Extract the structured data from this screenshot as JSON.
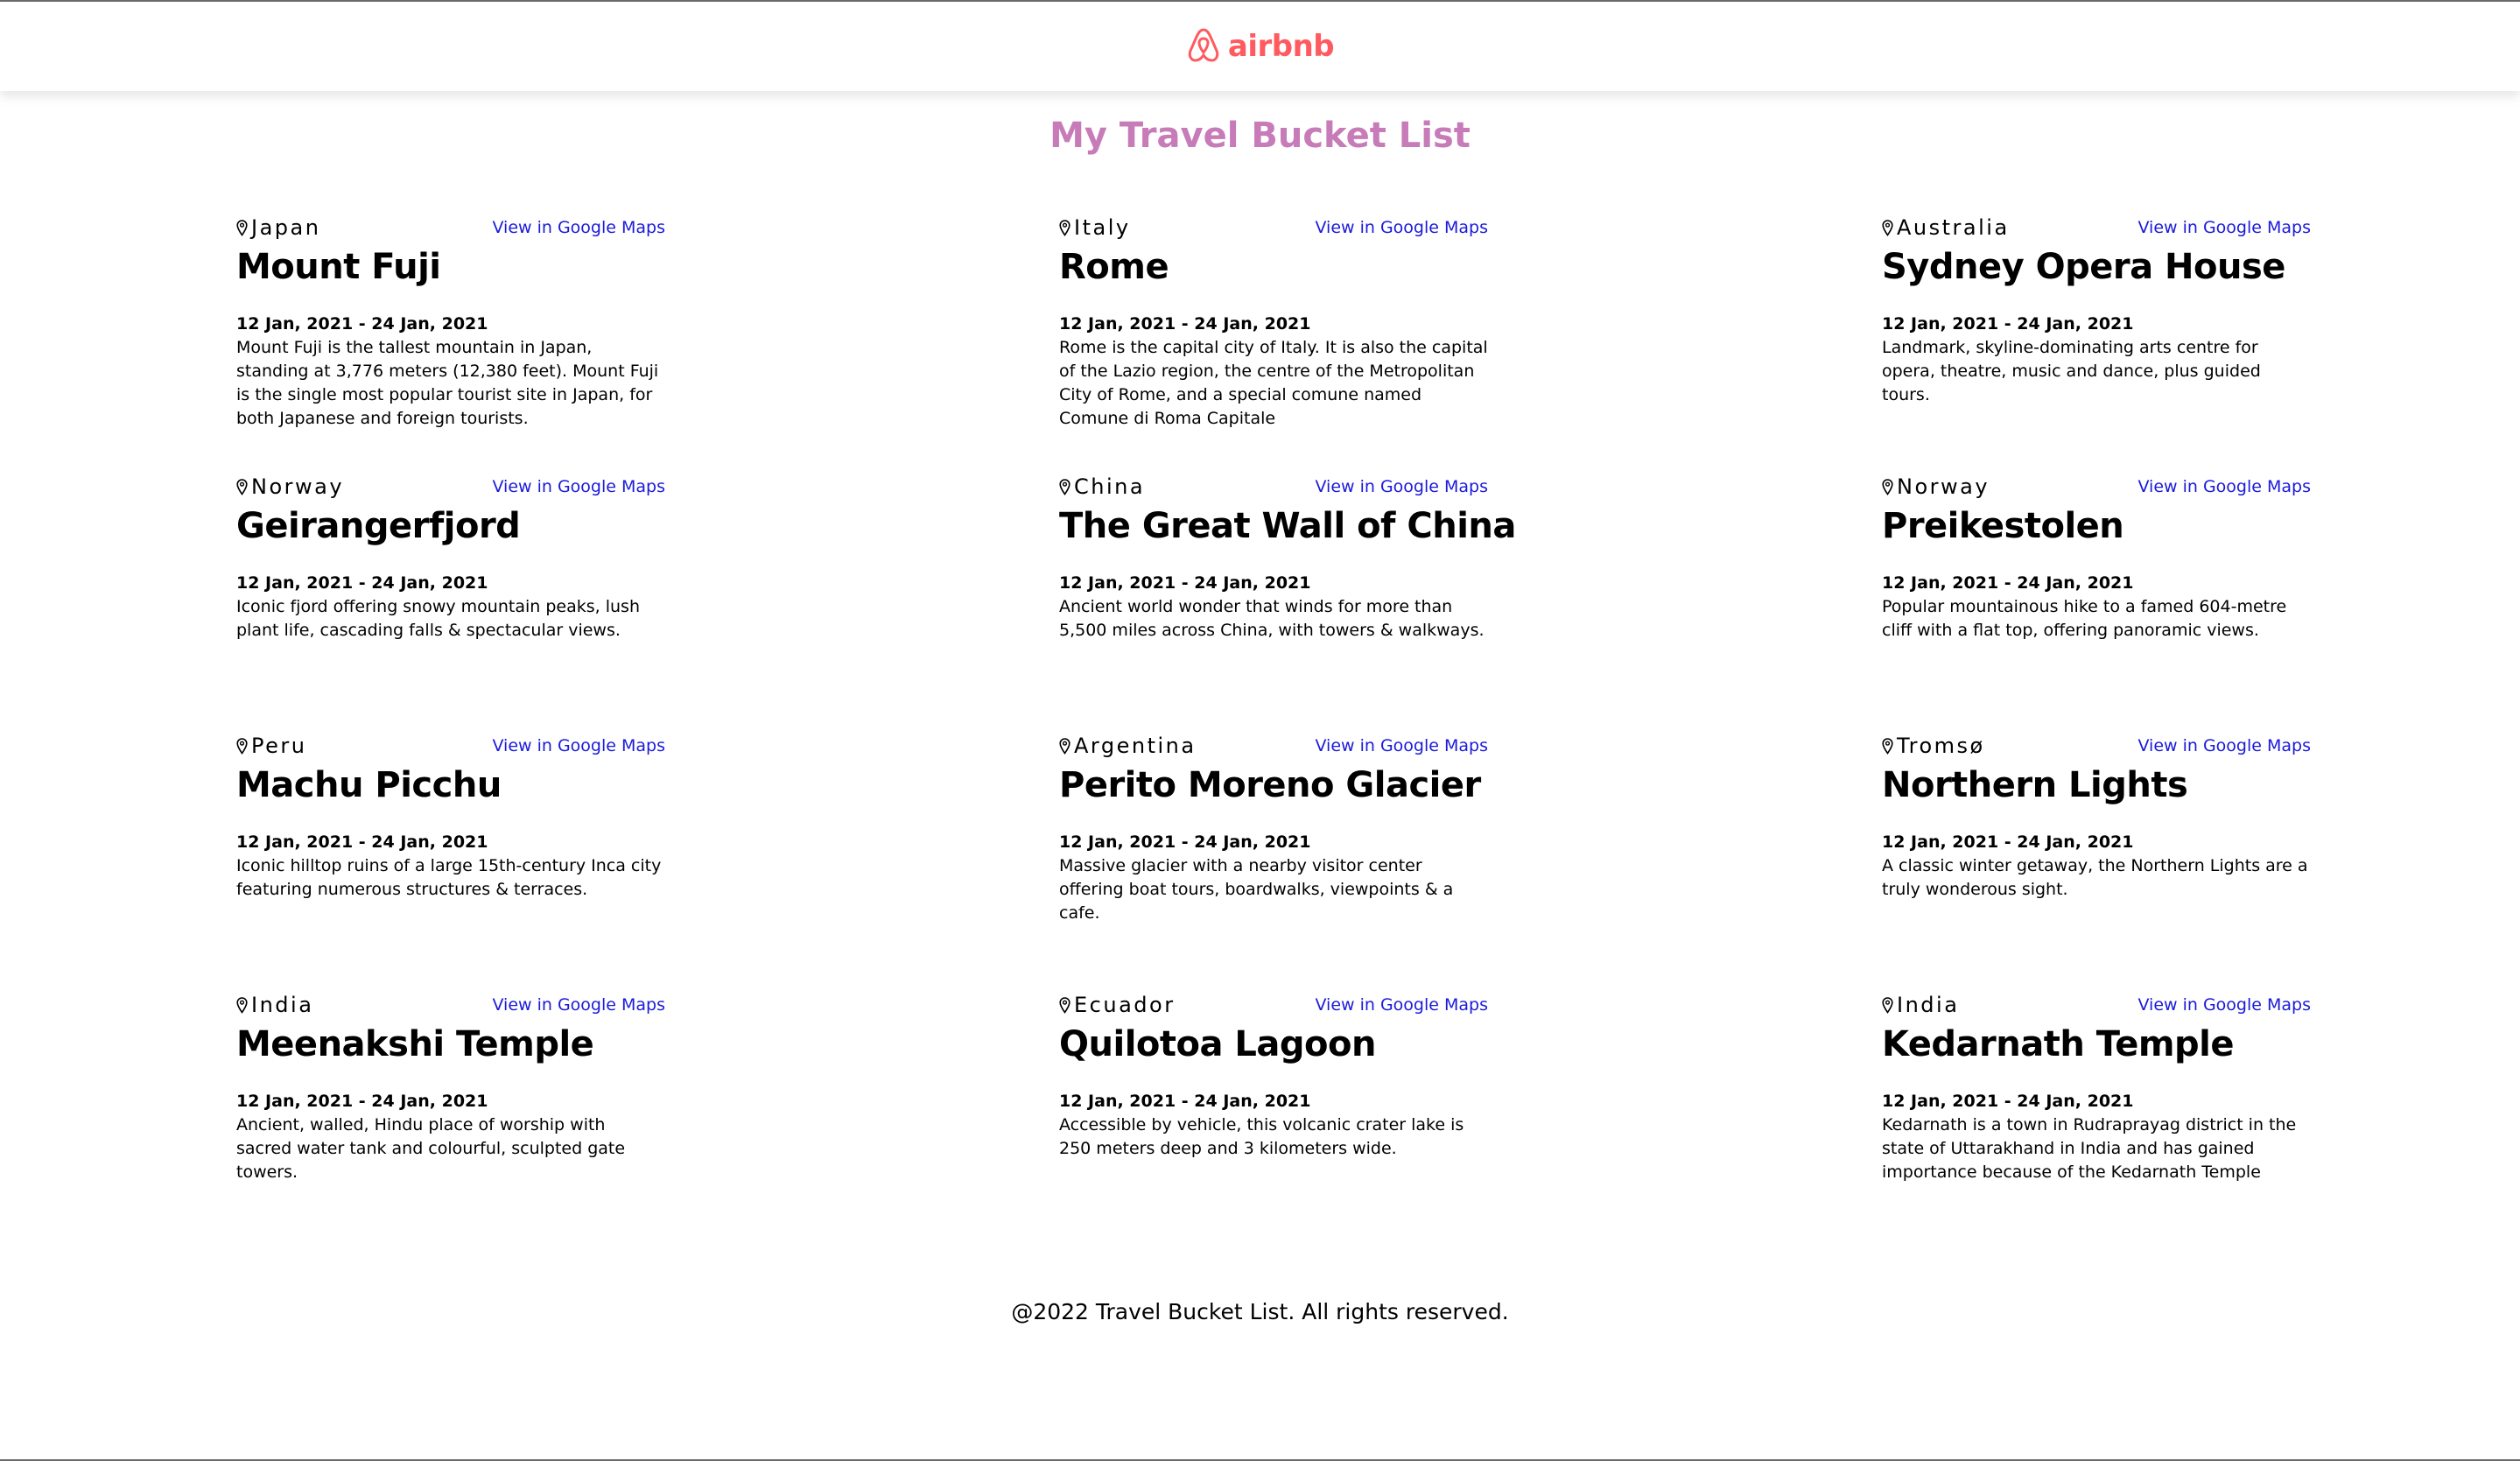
{
  "header": {
    "logo_text": "airbnb",
    "brand_color": "#FF5A5F",
    "logo_icon": "airbnb-logo-icon"
  },
  "page": {
    "title": "My Travel Bucket List",
    "title_color": "#C77BB8"
  },
  "entries": [
    {
      "country": "Japan",
      "link": "View in Google Maps",
      "title": "Mount Fuji",
      "dates": "12 Jan, 2021 - 24 Jan, 2021",
      "description": "Mount Fuji is the tallest mountain in Japan, standing at 3,776 meters (12,380 feet). Mount Fuji is the single most popular tourist site in Japan, for both Japanese and foreign tourists."
    },
    {
      "country": "Italy",
      "link": "View in Google Maps",
      "title": "Rome",
      "dates": "12 Jan, 2021 - 24 Jan, 2021",
      "description": "Rome is the capital city of Italy. It is also the capital of the Lazio region, the centre of the Metropolitan City of Rome, and a special comune named Comune di Roma Capitale"
    },
    {
      "country": "Australia",
      "link": "View in Google Maps",
      "title": "Sydney Opera House",
      "dates": "12 Jan, 2021 - 24 Jan, 2021",
      "description": "Landmark, skyline-dominating arts centre for opera, theatre, music and dance, plus guided tours."
    },
    {
      "country": "Norway",
      "link": "View in Google Maps",
      "title": "Geirangerfjord",
      "dates": "12 Jan, 2021 - 24 Jan, 2021",
      "description": "Iconic fjord offering snowy mountain peaks, lush plant life, cascading falls & spectacular views."
    },
    {
      "country": "China",
      "link": "View in Google Maps",
      "title": "The Great Wall of China",
      "dates": "12 Jan, 2021 - 24 Jan, 2021",
      "description": "Ancient world wonder that winds for more than 5,500 miles across China, with towers & walkways."
    },
    {
      "country": "Norway",
      "link": "View in Google Maps",
      "title": "Preikestolen",
      "dates": "12 Jan, 2021 - 24 Jan, 2021",
      "description": "Popular mountainous hike to a famed 604-metre cliff with a flat top, offering panoramic views."
    },
    {
      "country": "Peru",
      "link": "View in Google Maps",
      "title": "Machu Picchu",
      "dates": "12 Jan, 2021 - 24 Jan, 2021",
      "description": "Iconic hilltop ruins of a large 15th-century Inca city featuring numerous structures & terraces."
    },
    {
      "country": "Argentina",
      "link": "View in Google Maps",
      "title": "Perito Moreno Glacier",
      "dates": "12 Jan, 2021 - 24 Jan, 2021",
      "description": "Massive glacier with a nearby visitor center offering boat tours, boardwalks, viewpoints & a cafe."
    },
    {
      "country": "Tromsø",
      "link": "View in Google Maps",
      "title": "Northern Lights",
      "dates": "12 Jan, 2021 - 24 Jan, 2021",
      "description": "A classic winter getaway, the Northern Lights are a truly wonderous sight."
    },
    {
      "country": "India",
      "link": "View in Google Maps",
      "title": "Meenakshi Temple",
      "dates": "12 Jan, 2021 - 24 Jan, 2021",
      "description": "Ancient, walled, Hindu place of worship with sacred water tank and colourful, sculpted gate towers."
    },
    {
      "country": "Ecuador",
      "link": "View in Google Maps",
      "title": "Quilotoa Lagoon",
      "dates": "12 Jan, 2021 - 24 Jan, 2021",
      "description": "Accessible by vehicle, this volcanic crater lake is 250 meters deep and 3 kilometers wide."
    },
    {
      "country": "India",
      "link": "View in Google Maps",
      "title": "Kedarnath Temple",
      "dates": "12 Jan, 2021 - 24 Jan, 2021",
      "description": "Kedarnath is a town in Rudraprayag district in the state of Uttarakhand in India and has gained importance because of the Kedarnath Temple"
    }
  ],
  "icons": {
    "location": "location-pin-icon"
  },
  "link_color": "#1a1adb",
  "footer": {
    "text": "@2022 Travel Bucket List. All rights reserved."
  }
}
